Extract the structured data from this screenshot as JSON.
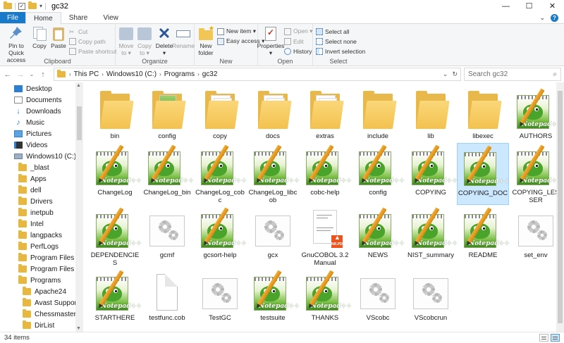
{
  "window": {
    "title": "gc32",
    "minimize": "—",
    "maximize": "☐",
    "close": "✕"
  },
  "tabs": {
    "file": "File",
    "items": [
      "Home",
      "Share",
      "View"
    ],
    "active": "Home",
    "expand": "⌄",
    "help": "?"
  },
  "ribbon": {
    "clipboard": {
      "label": "Clipboard",
      "pin": "Pin to Quick\naccess",
      "copy": "Copy",
      "paste": "Paste",
      "cut": "Cut",
      "copy_path": "Copy path",
      "paste_shortcut": "Paste shortcut"
    },
    "organize": {
      "label": "Organize",
      "move_to": "Move\nto ▾",
      "copy_to": "Copy\nto ▾",
      "delete": "Delete\n▾",
      "rename": "Rename"
    },
    "new": {
      "label": "New",
      "new_folder": "New\nfolder",
      "new_item": "New item ▾",
      "easy_access": "Easy access ▾"
    },
    "open": {
      "label": "Open",
      "properties": "Properties\n▾",
      "open": "Open ▾",
      "edit": "Edit",
      "history": "History"
    },
    "select": {
      "label": "Select",
      "select_all": "Select all",
      "select_none": "Select none",
      "invert": "Invert selection"
    }
  },
  "address": {
    "back": "←",
    "forward": "→",
    "recent": "⌄",
    "up": "↑",
    "crumbs": [
      "This PC",
      "Windows10 (C:)",
      "Programs",
      "gc32"
    ],
    "dropdown": "⌄",
    "refresh": "↻",
    "search_placeholder": "Search gc32",
    "search_icon": "⌕"
  },
  "navpane": {
    "items": [
      {
        "label": "Desktop",
        "icon": "desktop-icon"
      },
      {
        "label": "Documents",
        "icon": "documents-icon"
      },
      {
        "label": "Downloads",
        "icon": "downloads-icon"
      },
      {
        "label": "Music",
        "icon": "music-icon"
      },
      {
        "label": "Pictures",
        "icon": "pictures-icon"
      },
      {
        "label": "Videos",
        "icon": "videos-icon"
      },
      {
        "label": "Windows10 (C:)",
        "icon": "drive-icon"
      },
      {
        "label": "_blast",
        "icon": "folder-icon"
      },
      {
        "label": "Apps",
        "icon": "folder-icon"
      },
      {
        "label": "dell",
        "icon": "folder-icon"
      },
      {
        "label": "Drivers",
        "icon": "folder-icon"
      },
      {
        "label": "inetpub",
        "icon": "folder-icon"
      },
      {
        "label": "Intel",
        "icon": "folder-icon"
      },
      {
        "label": "langpacks",
        "icon": "folder-icon"
      },
      {
        "label": "PerfLogs",
        "icon": "folder-icon"
      },
      {
        "label": "Program Files",
        "icon": "folder-icon"
      },
      {
        "label": "Program Files (x86)",
        "icon": "folder-icon"
      },
      {
        "label": "Programs",
        "icon": "folder-icon"
      },
      {
        "label": "Apache24",
        "icon": "folder-icon"
      },
      {
        "label": "Avast Support Tool",
        "icon": "folder-icon"
      },
      {
        "label": "Chessmaster9000",
        "icon": "folder-icon"
      },
      {
        "label": "DirList",
        "icon": "folder-icon"
      }
    ]
  },
  "files": [
    {
      "name": "bin",
      "type": "folder"
    },
    {
      "name": "config",
      "type": "folder-thumb"
    },
    {
      "name": "copy",
      "type": "folder-docs"
    },
    {
      "name": "docs",
      "type": "folder-docs"
    },
    {
      "name": "extras",
      "type": "folder-docs"
    },
    {
      "name": "include",
      "type": "folder"
    },
    {
      "name": "lib",
      "type": "folder"
    },
    {
      "name": "libexec",
      "type": "folder"
    },
    {
      "name": "AUTHORS",
      "type": "notepad"
    },
    {
      "name": "ChangeLog",
      "type": "notepad"
    },
    {
      "name": "ChangeLog_bin",
      "type": "notepad"
    },
    {
      "name": "ChangeLog_cobc",
      "type": "notepad"
    },
    {
      "name": "ChangeLog_libcob",
      "type": "notepad"
    },
    {
      "name": "cobc-help",
      "type": "notepad"
    },
    {
      "name": "config",
      "type": "notepad"
    },
    {
      "name": "COPYING",
      "type": "notepad"
    },
    {
      "name": "COPYING_DOC",
      "type": "notepad",
      "selected": true
    },
    {
      "name": "COPYING_LESSER",
      "type": "notepad"
    },
    {
      "name": "DEPENDENCIES",
      "type": "notepad"
    },
    {
      "name": "gcmf",
      "type": "gear"
    },
    {
      "name": "gcsort-help",
      "type": "notepad"
    },
    {
      "name": "gcx",
      "type": "gear"
    },
    {
      "name": "GnuCOBOL 3.2 Manual",
      "type": "pdf"
    },
    {
      "name": "NEWS",
      "type": "notepad"
    },
    {
      "name": "NIST_summary",
      "type": "notepad"
    },
    {
      "name": "README",
      "type": "notepad"
    },
    {
      "name": "set_env",
      "type": "gear"
    },
    {
      "name": "STARTHERE",
      "type": "notepad"
    },
    {
      "name": "testfunc.cob",
      "type": "blank"
    },
    {
      "name": "TestGC",
      "type": "gear"
    },
    {
      "name": "testsuite",
      "type": "notepad"
    },
    {
      "name": "THANKS",
      "type": "notepad"
    },
    {
      "name": "VScobc",
      "type": "gear"
    },
    {
      "name": "VScobcrun",
      "type": "gear"
    }
  ],
  "notepad_badge": "Notepad++",
  "pdf_badge": "NR.PDF",
  "status": {
    "count": "34 items"
  },
  "colors": {
    "file_tab": "#1979ca",
    "selection": "#cce8ff",
    "folder": "#e9b84a"
  }
}
